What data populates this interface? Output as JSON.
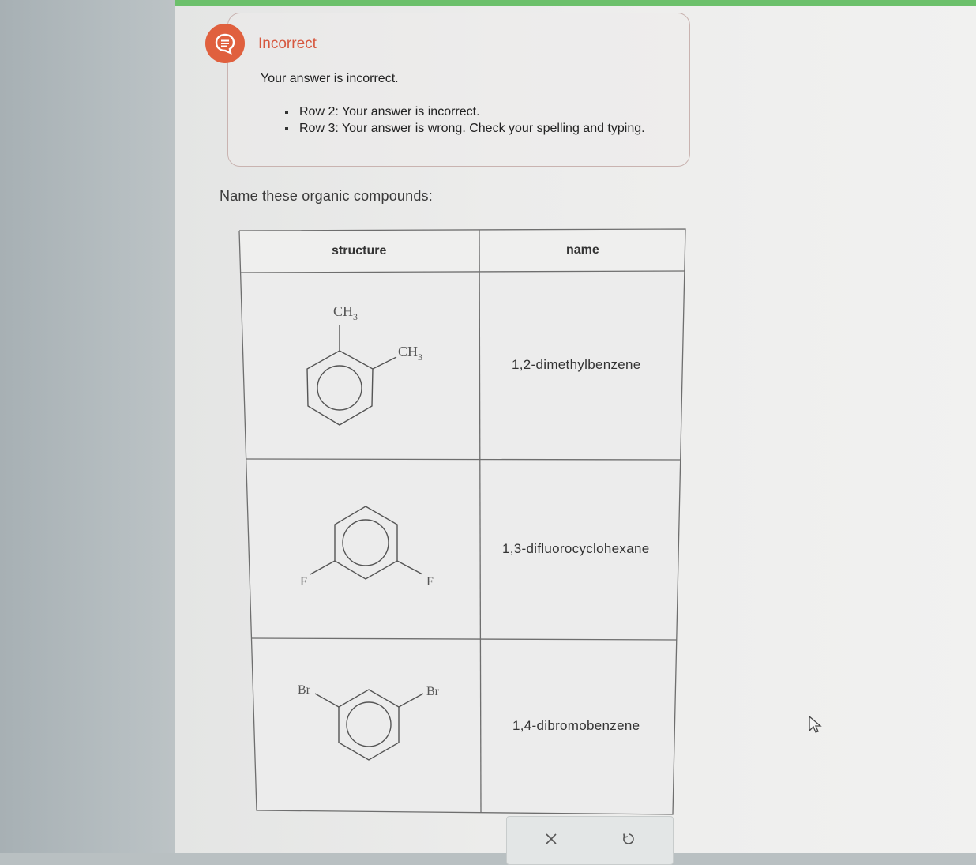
{
  "feedback": {
    "status_label": "Incorrect",
    "message": "Your answer is incorrect.",
    "errors": [
      "Row 2: Your answer is incorrect.",
      "Row 3: Your answer is wrong. Check your spelling and typing."
    ],
    "accent_color": "#e0603e"
  },
  "question": {
    "instruction": "Name these organic compounds:"
  },
  "table": {
    "headers": {
      "structure": "structure",
      "name": "name"
    },
    "rows": [
      {
        "labels": {
          "sub1": "CH",
          "sub1_sub": "3",
          "sub2": "CH",
          "sub2_sub": "3"
        },
        "answer": "1,2-dimethylbenzene"
      },
      {
        "labels": {
          "sub1": "F",
          "sub2": "F"
        },
        "answer": "1,3-difluorocyclohexane"
      },
      {
        "labels": {
          "sub1": "Br",
          "sub2": "Br"
        },
        "answer": "1,4-dibromobenzene"
      }
    ]
  },
  "actions": {
    "clear_icon": "x-icon",
    "undo_icon": "undo-icon"
  }
}
